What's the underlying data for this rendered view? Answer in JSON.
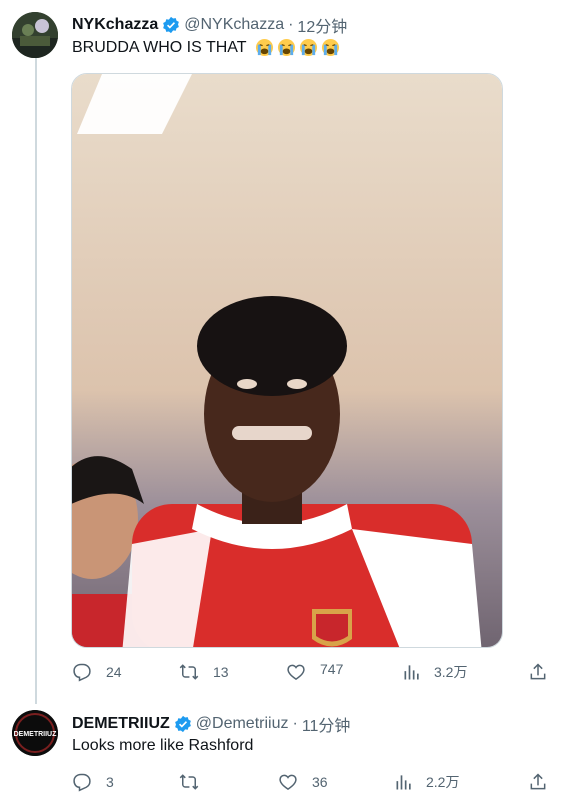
{
  "colors": {
    "verified": "#1d9bf0",
    "muted": "#536471",
    "thread_line": "#cfd9de"
  },
  "tweet1": {
    "name": "NYKchazza",
    "handle": "@NYKchazza",
    "separator": "·",
    "time": "12分钟",
    "text": "BRUDDA WHO IS THAT",
    "emojis": [
      "loudly-crying-face",
      "loudly-crying-face",
      "loudly-crying-face",
      "loudly-crying-face"
    ],
    "actions": {
      "replies": "24",
      "reposts": "13",
      "likes": "747",
      "views": "3.2万"
    }
  },
  "tweet2": {
    "name": "DEMETRIIUZ",
    "avatar_text": "DEMETRIIUZ",
    "handle": "@Demetriiuz",
    "separator": "·",
    "time": "11分钟",
    "text": "Looks more like Rashford",
    "actions": {
      "replies": "3",
      "reposts": "",
      "likes": "36",
      "views": "2.2万"
    }
  }
}
